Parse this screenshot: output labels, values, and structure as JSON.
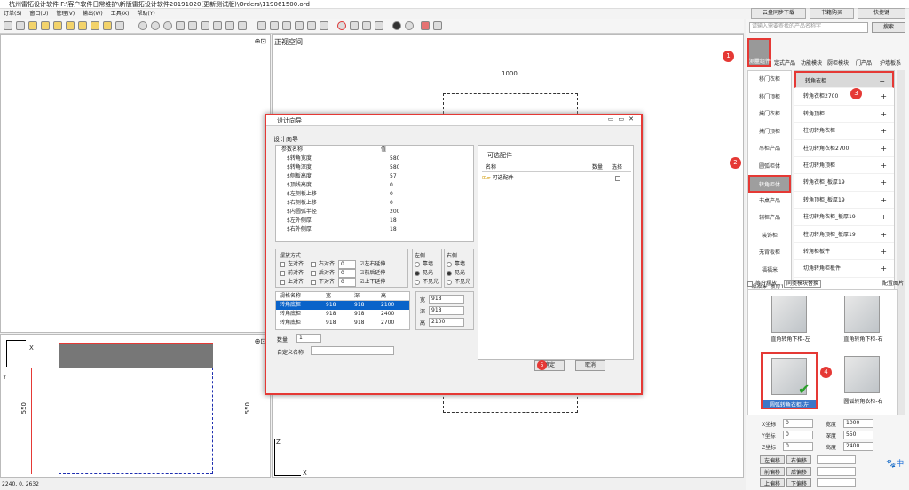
{
  "window": {
    "title": "杭州雷拓设计软件 F:\\客户软件日常维护\\新版雷拓设计软件20191020(更新测试版)\\Orders\\119061500.ord"
  },
  "menu": [
    "订单(S)",
    "窗口(U)",
    "管理(V)",
    "输出(W)",
    "工具(X)",
    "帮助(Y)"
  ],
  "top_buttons": {
    "cloud": "云盘同步下载",
    "bookmark": "书籍购买",
    "shortcut": "快捷键"
  },
  "search": {
    "placeholder": "请输入需要查找的产品名称字",
    "button": "搜索"
  },
  "view": {
    "front_label": "正视空间",
    "dim_top": "1000",
    "dim_left": "550",
    "dim_right": "550",
    "axis_x": "X",
    "axis_y": "Y",
    "axis_z": "Z"
  },
  "status": {
    "coords": "2240, 0, 2632"
  },
  "categories_top": [
    "测量组件",
    "定式产品",
    "功能模块",
    "厨柜模块",
    "门产品",
    "护墙板系"
  ],
  "left_categories": [
    "移门衣柜",
    "移门顶柜",
    "掩门衣柜",
    "掩门顶柜",
    "吊柜产品",
    "圆弧柜体",
    "转角柜体",
    "书桌产品",
    "辅柜产品",
    "装饰柜",
    "无背板柜",
    "福福米",
    "福福米_板厚19"
  ],
  "right_items": {
    "header": "转角衣柜",
    "items": [
      "转角衣柜2700",
      "转角顶柜",
      "柱切转角衣柜",
      "柱切转角衣柜2700",
      "柱切转角顶柜",
      "转角衣柜_板厚19",
      "转角顶柜_板厚19",
      "柱切转角衣柜_板厚19",
      "柱切转角顶柜_板厚19",
      "转角柜板件",
      "切角转角柜板件"
    ]
  },
  "panel_tabs": {
    "equal": "等分摆放",
    "replace": "同类模块替换",
    "match": "配置图片"
  },
  "thumbs": [
    "直角转角下柜-左",
    "直角转角下柜-右",
    "圆弧转角衣柜-左",
    "圆弧转角衣柜-右"
  ],
  "props": {
    "x_label": "X坐标",
    "x": "0",
    "y_label": "Y坐标",
    "y": "0",
    "z_label": "Z坐标",
    "z": "0",
    "w_label": "宽度",
    "w": "1000",
    "d_label": "深度",
    "d": "550",
    "h_label": "高度",
    "h": "2400"
  },
  "move_btns": [
    "左偏移",
    "右偏移",
    "前偏移",
    "后偏移",
    "上偏移",
    "下偏移"
  ],
  "markers": [
    "1",
    "2",
    "3",
    "4",
    "5"
  ],
  "dialog": {
    "title": "设计向导",
    "section": "设计向导",
    "param_headers": [
      "参数名称",
      "值"
    ],
    "params": [
      [
        "$转角宽度",
        "580"
      ],
      [
        "$转角深度",
        "580"
      ],
      [
        "$侧板高度",
        "57"
      ],
      [
        "$顶线高度",
        "0"
      ],
      [
        "$左侧板上移",
        "0"
      ],
      [
        "$右侧板上移",
        "0"
      ],
      [
        "$内圆弧半径",
        "200"
      ],
      [
        "$左外侧厚",
        "18"
      ],
      [
        "$右外侧厚",
        "18"
      ]
    ],
    "optional_title": "可选配件",
    "opt_headers": [
      "名称",
      "数量",
      "选择"
    ],
    "opt_item": "可选配件",
    "place_title": "摆放方式",
    "place_rows": [
      [
        "左对齐",
        "右对齐",
        "0",
        "左右延伸"
      ],
      [
        "前对齐",
        "后对齐",
        "0",
        "前后延伸"
      ],
      [
        "上对齐",
        "下对齐",
        "0",
        "上下延伸"
      ]
    ],
    "left_side": {
      "title": "左侧",
      "opts": [
        "靠墙",
        "见光",
        "不见光"
      ]
    },
    "right_side": {
      "title": "右侧",
      "opts": [
        "靠墙",
        "见光",
        "不见光"
      ]
    },
    "spec_headers": [
      "规格名称",
      "宽",
      "深",
      "高"
    ],
    "specs": [
      [
        "转角底柜",
        "918",
        "918",
        "2100"
      ],
      [
        "转角底柜",
        "918",
        "918",
        "2400"
      ],
      [
        "转角底柜",
        "918",
        "918",
        "2700"
      ]
    ],
    "dims": {
      "w_label": "宽",
      "w": "918",
      "d_label": "深",
      "d": "918",
      "h_label": "高",
      "h": "2100"
    },
    "qty_label": "数量",
    "qty": "1",
    "custom_label": "自定义名称",
    "ok": "确定",
    "cancel": "取消"
  },
  "colors": {
    "accent": "#e53935",
    "selected": "#0a63c9"
  }
}
